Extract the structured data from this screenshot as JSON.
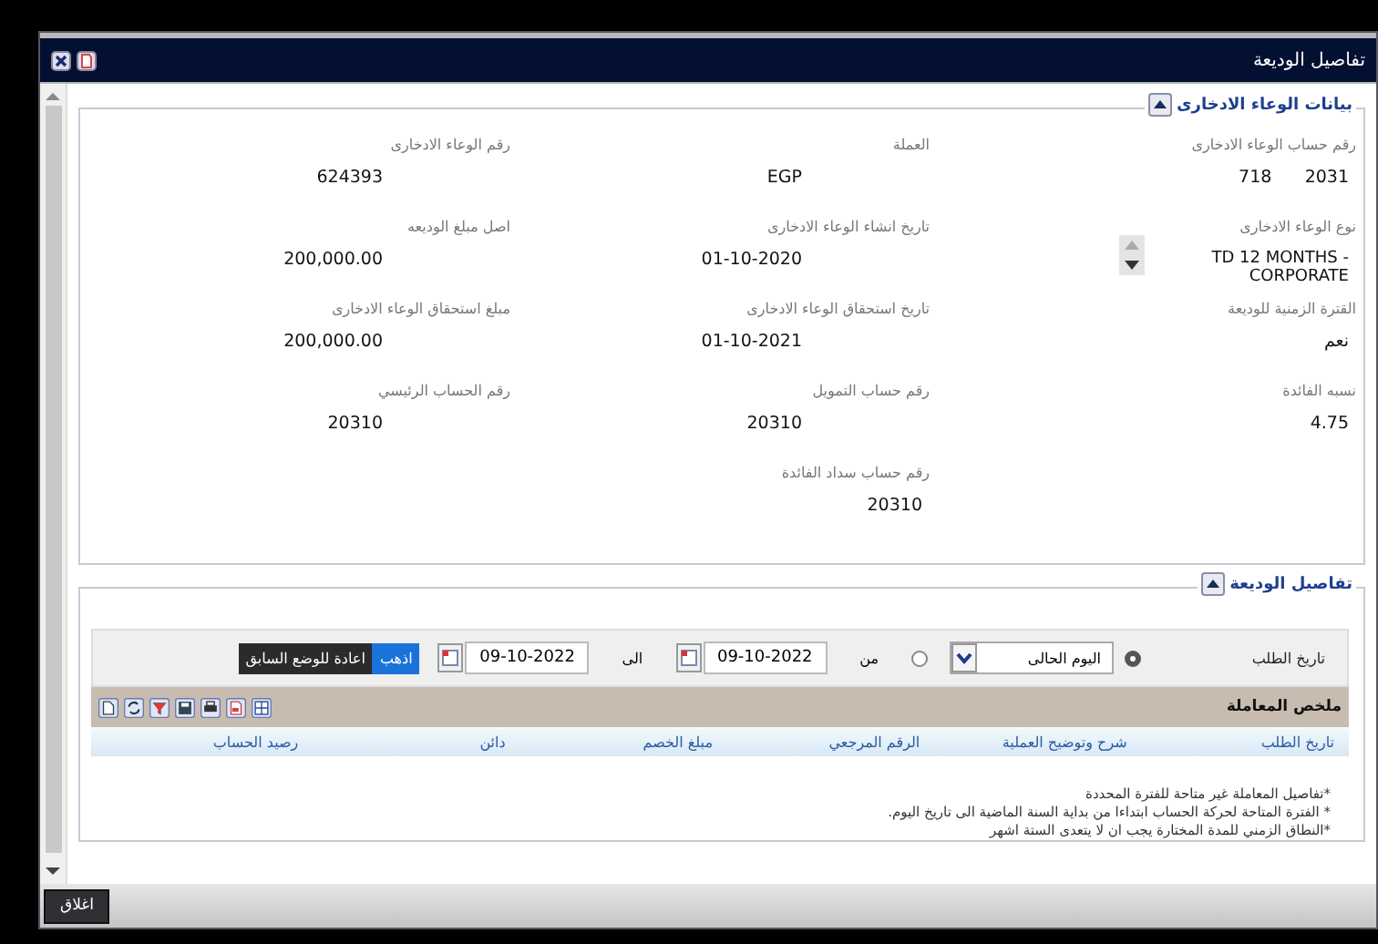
{
  "window": {
    "title": "تفاصيل الوديعة"
  },
  "savings_info": {
    "title": "بيانات الوعاء الادخارى",
    "expanded": true,
    "fields": [
      {
        "kind": "text",
        "label": "رقم حساب الوعاء الادخارى",
        "value": "2031      718"
      },
      {
        "kind": "text",
        "label": "العملة",
        "value": "EGP"
      },
      {
        "kind": "text",
        "label": "رقم الوعاء الادخارى",
        "value": "624393"
      },
      {
        "kind": "stepper",
        "label": "نوع الوعاء الادخارى",
        "value": "TD 12 MONTHS - CORPORATE"
      },
      {
        "kind": "text",
        "label": "تاريخ انشاء الوعاء الادخارى",
        "value": "01-10-2020"
      },
      {
        "kind": "text",
        "label": "اصل مبلغ الوديعه",
        "value": "200,000.00"
      },
      {
        "kind": "text",
        "label": "القترة الزمنية للوديعة",
        "value": "نعم"
      },
      {
        "kind": "text",
        "label": "تاريخ استحقاق الوعاء الادخارى",
        "value": "01-10-2021"
      },
      {
        "kind": "text",
        "label": "مبلغ استحقاق الوعاء الادخارى",
        "value": "200,000.00"
      },
      {
        "kind": "text",
        "label": "نسبه الفائدة",
        "value": "4.75"
      },
      {
        "kind": "text",
        "label": "رقم حساب التمويل",
        "value": "20310"
      },
      {
        "kind": "text",
        "label": "رقم الحساب الرئيسي",
        "value": "20310"
      },
      {
        "kind": "text",
        "label": "رقم حساب سداد الفائدة",
        "value": "20310"
      }
    ]
  },
  "deposit_details": {
    "title": "تفاصيل الوديعة",
    "expanded": true,
    "filter": {
      "label": "تاريخ الطلب",
      "options": [
        {
          "kind": "select",
          "selected": true,
          "value": "اليوم الحالى"
        },
        {
          "kind": "range",
          "selected": false,
          "from_label": "من",
          "from": "09-10-2022",
          "to_label": "الى",
          "to": "09-10-2022"
        }
      ],
      "buttons": [
        {
          "kind": "primary",
          "label": "اذهب"
        },
        {
          "kind": "secondary",
          "label": "اعادة للوضع السابق"
        }
      ]
    },
    "summary": {
      "title": "ملخص المعاملة"
    },
    "table": {
      "columns": [
        "تاريخ الطلب",
        "شرح وتوضيح العملية",
        "الرقم المرجعي",
        "مبلغ الخصم",
        "دائن",
        "رصيد الحساب"
      ]
    },
    "notes": [
      "*تفاصيل المعاملة غير متاحة للفترة المحددة",
      "* الفترة المتاحة لحركة الحساب ابتداءا من بداية السنة الماضية الى تاريخ اليوم.",
      "*النطاق الزمني للمدة المختارة يجب ان لا يتعدى الستة اشهر"
    ]
  },
  "footer": {
    "buttons": [
      "اغلاق"
    ]
  }
}
